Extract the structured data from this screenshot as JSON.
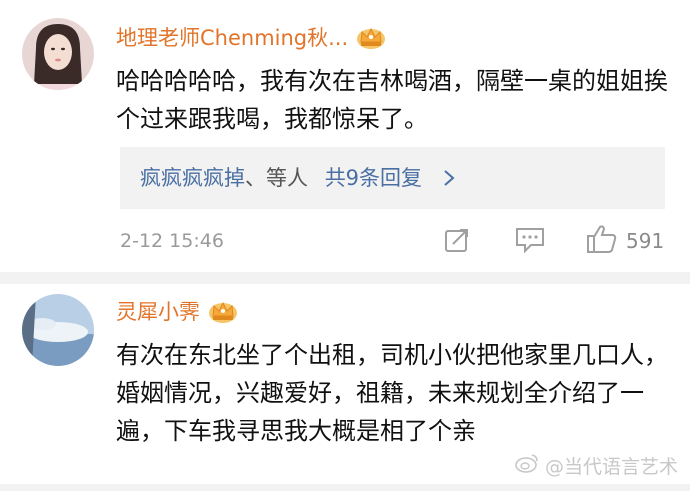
{
  "comments": [
    {
      "username": "地理老师Chenming秋...",
      "text": "哈哈哈哈哈，我有次在吉林喝酒，隔壁一桌的姐姐挨个过来跟我喝，我都惊呆了。",
      "reply_users": "疯疯疯疯掉、等人",
      "reply_prefix": "疯疯疯疯掉",
      "reply_mid": "、等人",
      "reply_count": "共9条回复",
      "timestamp": "2-12 15:46",
      "likes": "591"
    },
    {
      "username": "灵犀小霁",
      "text": "有次在东北坐了个出租，司机小伙把他家里几口人，婚姻情况，兴趣爱好，祖籍，未来规划全介绍了一遍，下车我寻思我大概是相了个亲"
    }
  ],
  "watermark": "@当代语言艺术",
  "icons": {
    "crown": "crown-badge-icon",
    "share": "share-icon",
    "comment": "comment-icon",
    "like": "thumbs-up-icon",
    "chevron": "chevron-right-icon",
    "weibo": "weibo-logo-icon"
  },
  "colors": {
    "username": "#e2742a",
    "link": "#4a6fa3",
    "meta": "#9a9a9a",
    "reply_bg": "#f2f2f2"
  }
}
